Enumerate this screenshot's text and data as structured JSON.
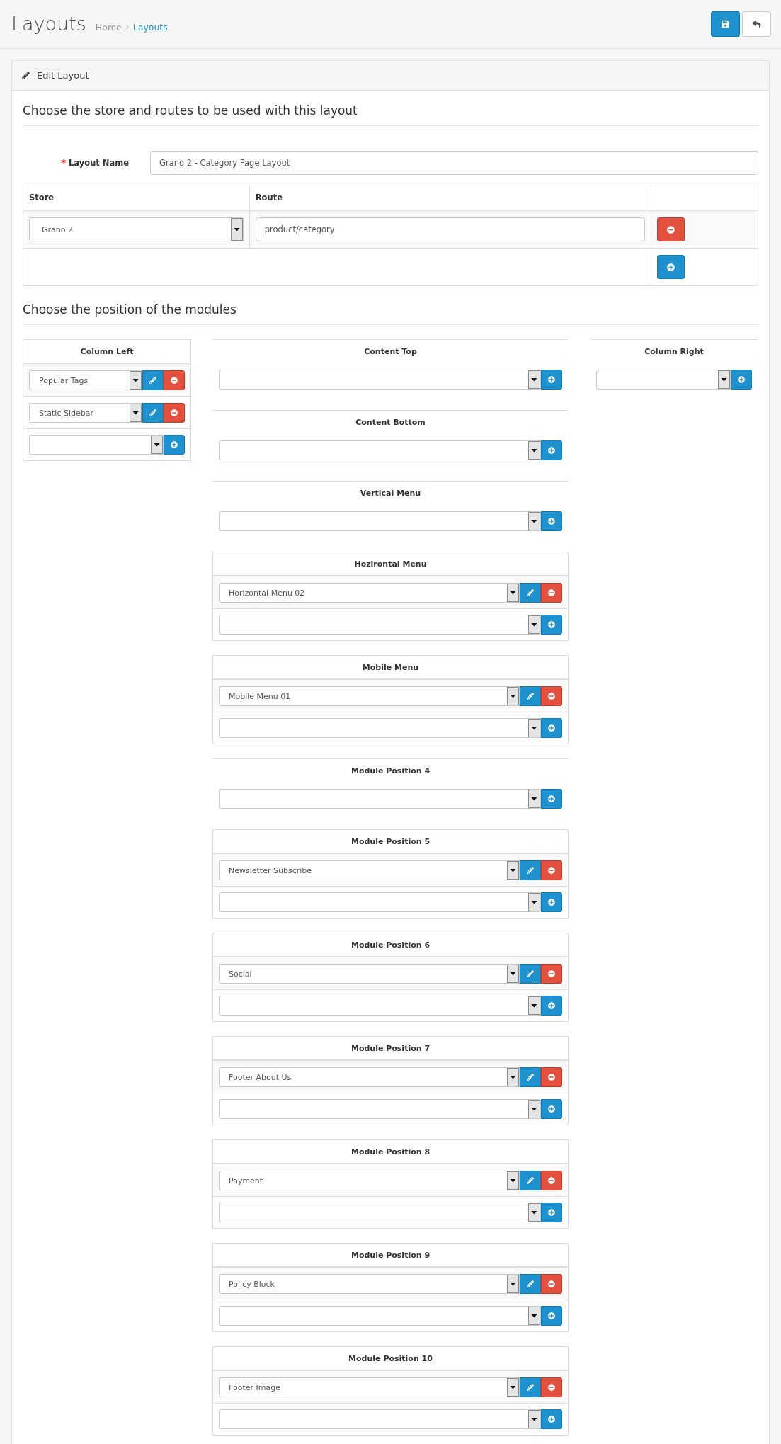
{
  "header": {
    "title": "Layouts",
    "breadcrumb": [
      {
        "label": "Home",
        "selected": false
      },
      {
        "label": "Layouts",
        "selected": true
      }
    ]
  },
  "panel": {
    "title": "Edit Layout"
  },
  "store_section": {
    "heading": "Choose the store and routes to be used with this layout",
    "layout_name": {
      "required_mark": "*",
      "label": "Layout Name",
      "value": "Grano 2 - Category Page Layout"
    },
    "routes_table": {
      "columns": [
        "Store",
        "Route"
      ],
      "rows": [
        {
          "store": "Grano 2",
          "route": "product/category"
        }
      ]
    }
  },
  "modules_section": {
    "heading": "Choose the position of the modules",
    "columns": [
      {
        "positions": [
          {
            "title": "Column Left",
            "modules": [
              "Popular Tags",
              "Static Sidebar"
            ]
          }
        ]
      },
      {
        "positions": [
          {
            "title": "Content Top"
          },
          {
            "title": "Content Bottom"
          },
          {
            "title": "Vertical Menu"
          },
          {
            "title": "Hozirontal Menu",
            "modules": [
              "Horizontal Menu 02"
            ]
          },
          {
            "title": "Mobile Menu",
            "modules": [
              "Mobile Menu 01"
            ]
          },
          {
            "title": "Module Position 4"
          },
          {
            "title": "Module Position 5",
            "modules": [
              "Newsletter Subscribe"
            ]
          },
          {
            "title": "Module Position 6",
            "modules": [
              "Social"
            ]
          },
          {
            "title": "Module Position 7",
            "modules": [
              "Footer About Us"
            ]
          },
          {
            "title": "Module Position 8",
            "modules": [
              "Payment"
            ]
          },
          {
            "title": "Module Position 9",
            "modules": [
              "Policy Block"
            ]
          },
          {
            "title": "Module Position 10",
            "modules": [
              "Footer Image"
            ]
          }
        ]
      },
      {
        "positions": [
          {
            "title": "Column Right"
          }
        ]
      }
    ]
  }
}
